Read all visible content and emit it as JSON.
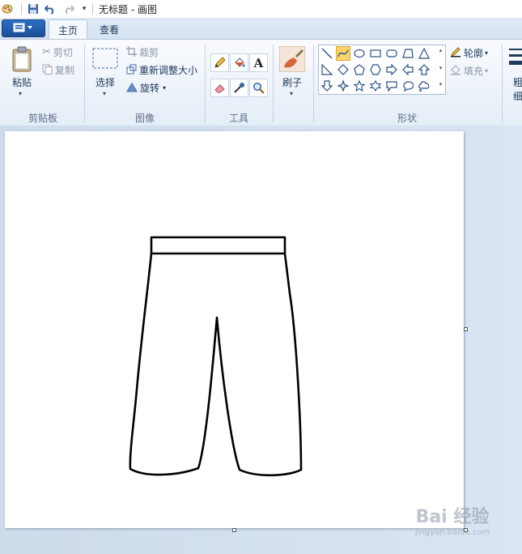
{
  "title_bar": {
    "title": "无标题 - 画图",
    "icons": [
      "paint-app-icon",
      "save-icon",
      "undo-icon",
      "redo-icon",
      "customize-dropdown-icon"
    ]
  },
  "tabs": {
    "file_icon": "file-menu-icon",
    "home": "主页",
    "view": "查看"
  },
  "ribbon": {
    "clipboard": {
      "paste": "粘贴",
      "cut": "剪切",
      "copy": "复制",
      "group": "剪贴板"
    },
    "image": {
      "select": "选择",
      "crop": "裁剪",
      "resize": "重新调整大小",
      "rotate": "旋转",
      "group": "图像"
    },
    "tools": {
      "group": "工具",
      "items": [
        "pencil-icon",
        "fill-icon",
        "text-icon",
        "eraser-icon",
        "color-picker-icon",
        "magnifier-icon"
      ],
      "text_glyph": "A"
    },
    "brush": {
      "label": "刷子"
    },
    "shapes": {
      "group": "形状",
      "outline": "轮廓",
      "fill": "填充",
      "selected": "curve-shape"
    },
    "size": {
      "label_top": "粗",
      "label_bottom": "细"
    }
  },
  "canvas": {
    "drawing": "pants-drawing"
  },
  "watermark": {
    "line1": "Bai 经验",
    "line2": "jingyan.baidu.com"
  },
  "colors": {
    "accent": "#1a4f99",
    "ribbon": "#e5edf7",
    "workspace": "#cedbeb",
    "selected_shape": "#fbd36b"
  }
}
